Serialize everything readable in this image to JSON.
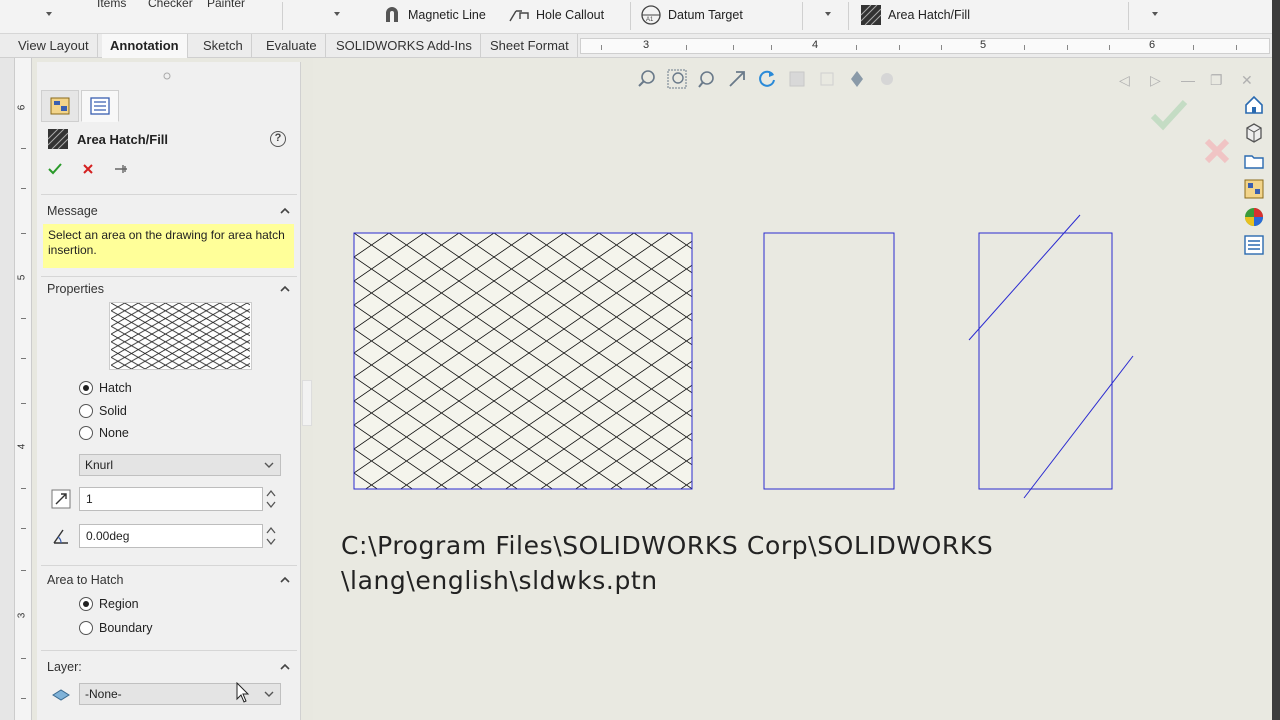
{
  "toolbar": {
    "cut_labels": [
      "Items",
      "Checker",
      "Painter"
    ],
    "magnetic_line": "Magnetic Line",
    "hole_callout": "Hole Callout",
    "datum_target": "Datum Target",
    "area_hatch_fill": "Area Hatch/Fill"
  },
  "tabs": [
    "View Layout",
    "Annotation",
    "Sketch",
    "Evaluate",
    "SOLIDWORKS Add-Ins",
    "Sheet Format"
  ],
  "active_tab": "Annotation",
  "ruler": {
    "numbers": [
      "3",
      "4",
      "5",
      "6"
    ]
  },
  "vruler": {
    "numbers": [
      "6",
      "5",
      "4",
      "3"
    ]
  },
  "property_manager": {
    "title": "Area Hatch/Fill",
    "help": "?",
    "message": {
      "heading": "Message",
      "text": "Select an area on the drawing for area hatch insertion."
    },
    "properties": {
      "heading": "Properties",
      "options": [
        {
          "label": "Hatch",
          "selected": true
        },
        {
          "label": "Solid",
          "selected": false
        },
        {
          "label": "None",
          "selected": false
        }
      ],
      "pattern": "Knurl",
      "scale": "1",
      "angle": "0.00deg"
    },
    "area_to_hatch": {
      "heading": "Area to Hatch",
      "options": [
        {
          "label": "Region",
          "selected": true
        },
        {
          "label": "Boundary",
          "selected": false
        }
      ]
    },
    "layer": {
      "heading": "Layer:",
      "value": "-None-"
    }
  },
  "drawing": {
    "path_line1": "C:\\Program Files\\SOLIDWORKS Corp\\SOLIDWORKS",
    "path_line2": "\\lang\\english\\sldwks.ptn"
  },
  "colors": {
    "sketch_blue": "#2a2ad0",
    "accept_green": "#2a9a2a",
    "cancel_red": "#d42020",
    "message_yellow": "#ffff99"
  }
}
